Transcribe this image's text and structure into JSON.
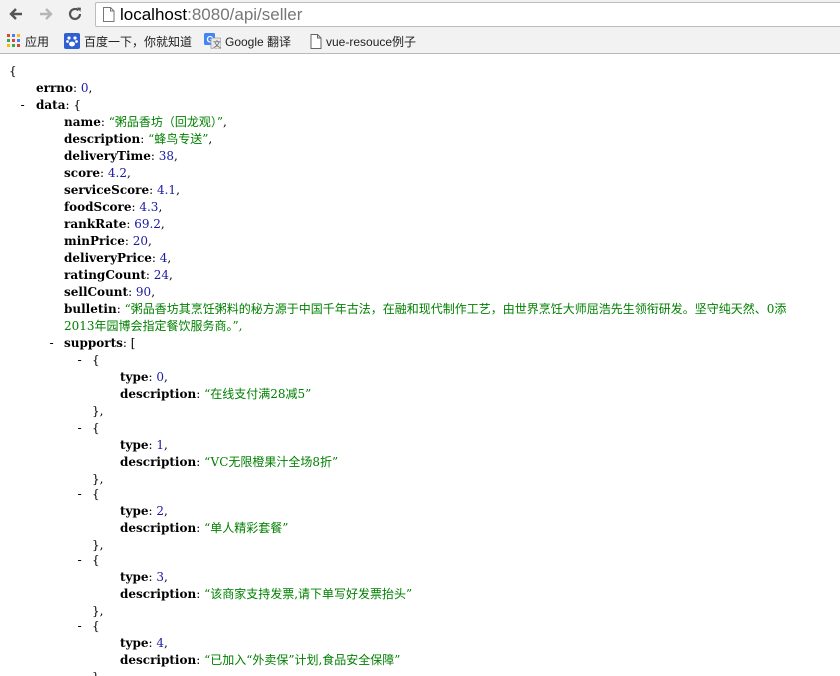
{
  "browser": {
    "url_host": "localhost",
    "url_rest": ":8080/api/seller",
    "bookmarks": [
      {
        "label": "应用",
        "icon": "apps-grid-icon"
      },
      {
        "label": "百度一下，你就知道",
        "icon": "baidu-paw-icon"
      },
      {
        "label": "Google 翻译",
        "icon": "google-translate-icon"
      },
      {
        "label": "vue-resouce例子",
        "icon": "page-icon"
      }
    ]
  },
  "json": {
    "open_brace": "{",
    "errno": {
      "key": "errno",
      "value": "0"
    },
    "data_key": "data",
    "fields": [
      {
        "key": "name",
        "value": "“粥品香坊（回龙观）”",
        "type": "str"
      },
      {
        "key": "description",
        "value": "“蜂鸟专送”",
        "type": "str"
      },
      {
        "key": "deliveryTime",
        "value": "38",
        "type": "num"
      },
      {
        "key": "score",
        "value": "4.2",
        "type": "num"
      },
      {
        "key": "serviceScore",
        "value": "4.1",
        "type": "num"
      },
      {
        "key": "foodScore",
        "value": "4.3",
        "type": "num"
      },
      {
        "key": "rankRate",
        "value": "69.2",
        "type": "num"
      },
      {
        "key": "minPrice",
        "value": "20",
        "type": "num"
      },
      {
        "key": "deliveryPrice",
        "value": "4",
        "type": "num"
      },
      {
        "key": "ratingCount",
        "value": "24",
        "type": "num"
      },
      {
        "key": "sellCount",
        "value": "90",
        "type": "num"
      }
    ],
    "bulletin_key": "bulletin",
    "bulletin_line1": "“粥品香坊其烹饪粥料的秘方源于中国千年古法，在融和现代制作工艺，由世界烹饪大师屈浩先生领衔研发。坚守纯天然、0添",
    "bulletin_line2": "2013年园博会指定餐饮服务商。”,",
    "supports_key": "supports",
    "supports": [
      {
        "type": "0",
        "description": "“在线支付满28减5”"
      },
      {
        "type": "1",
        "description": "“VC无限橙果汁全场8折”"
      },
      {
        "type": "2",
        "description": "“单人精彩套餐”"
      },
      {
        "type": "3",
        "description": "“该商家支持发票,请下单写好发票抬头”"
      },
      {
        "type": "4",
        "description": "“已加入“外卖保”计划,食品安全保障”"
      }
    ]
  }
}
